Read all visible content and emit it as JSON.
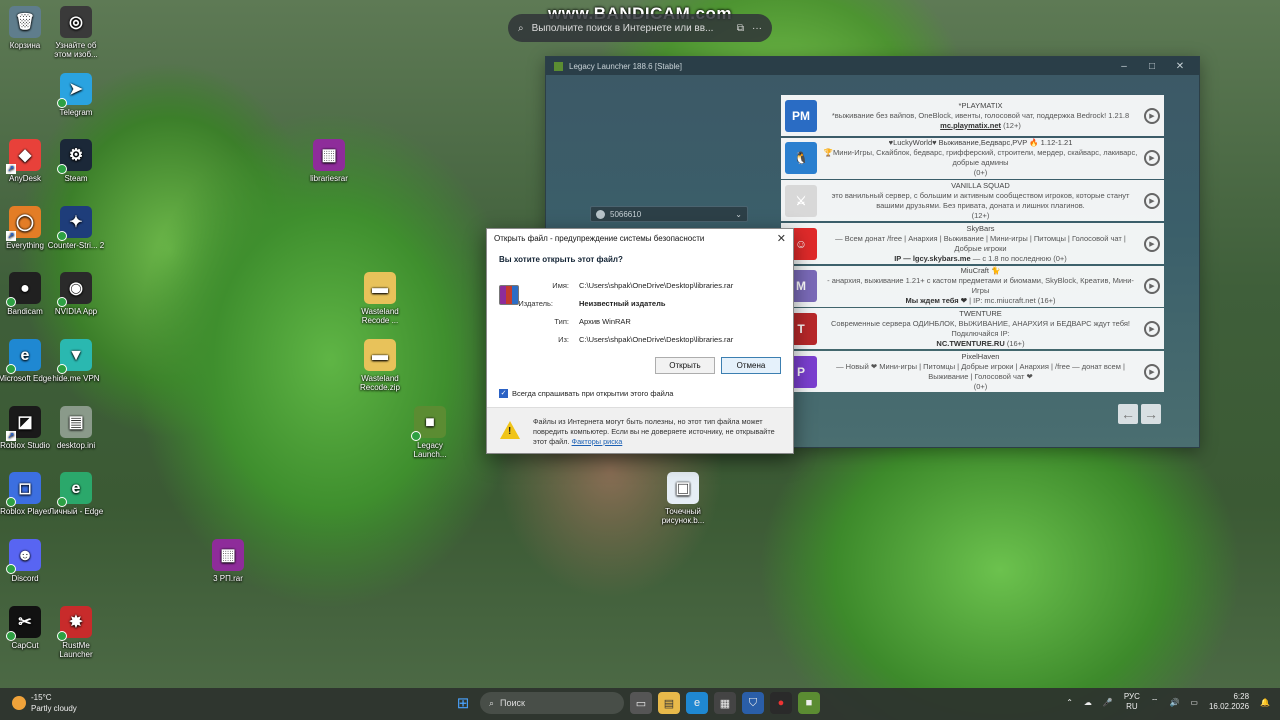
{
  "overlay": {
    "watermark": "www.BANDICAM.com",
    "search_placeholder": "Выполните поиск в Интернете или вв..."
  },
  "desktop_icons": [
    {
      "label": "Корзина",
      "icon": "recycle-bin-icon",
      "color": "#5f7d8c"
    },
    {
      "label": "Узнайте об этом изоб...",
      "icon": "camera-icon",
      "color": "#3a3a3a"
    },
    {
      "label": "Telegram",
      "icon": "telegram-icon",
      "color": "#2aa3e0"
    },
    {
      "label": "AnyDesk",
      "icon": "anydesk-icon",
      "color": "#e8413a"
    },
    {
      "label": "Steam",
      "icon": "steam-icon",
      "color": "#1b2838"
    },
    {
      "label": "Everything",
      "icon": "search-icon",
      "color": "#e37d26"
    },
    {
      "label": "Counter-Stri... 2",
      "icon": "counter-strike-icon",
      "color": "#1e3d7a"
    },
    {
      "label": "Bandicam",
      "icon": "record-icon",
      "color": "#202020"
    },
    {
      "label": "NVIDIA App",
      "icon": "nvidia-icon",
      "color": "#2a2a2a"
    },
    {
      "label": "Microsoft Edge",
      "icon": "edge-icon",
      "color": "#1f88d2"
    },
    {
      "label": "hide.me VPN",
      "icon": "vpn-icon",
      "color": "#2ab8b0"
    },
    {
      "label": "Roblox Studio",
      "icon": "roblox-studio-icon",
      "color": "#1a1a1a"
    },
    {
      "label": "desktop.ini",
      "icon": "file-icon",
      "color": "#8a9a8a"
    },
    {
      "label": "Roblox Player",
      "icon": "roblox-icon",
      "color": "#3c6fe0"
    },
    {
      "label": "Личный - Edge",
      "icon": "edge-profile-icon",
      "color": "#2ba86b"
    },
    {
      "label": "Discord",
      "icon": "discord-icon",
      "color": "#5865f2"
    },
    {
      "label": "CapCut",
      "icon": "capcut-icon",
      "color": "#111111"
    },
    {
      "label": "RustMe Launcher",
      "icon": "rustme-icon",
      "color": "#c82b2b"
    },
    {
      "label": "librariesrar",
      "icon": "winrar-icon",
      "color": "#8e2c9a"
    },
    {
      "label": "Wasteland Recode ...",
      "icon": "folder-icon",
      "color": "#e8c25a"
    },
    {
      "label": "Wasteland Recode.zip",
      "icon": "zip-folder-icon",
      "color": "#e8c25a"
    },
    {
      "label": "Legacy Launch...",
      "icon": "minecraft-icon",
      "color": "#5b8c32"
    },
    {
      "label": "3 РП.rar",
      "icon": "winrar-icon",
      "color": "#8e2c9a"
    },
    {
      "label": "Точечный рисунок.b...",
      "icon": "bitmap-icon",
      "color": "#e6eef5"
    }
  ],
  "launcher": {
    "title": "Legacy Launcher 188.6 [Stable]",
    "account": "5066610",
    "servers": [
      {
        "name": "*PLAYMATIX",
        "desc": "*выживание без вайпов, OneBlock, ивенты, голосовой чат, поддержка Bedrock! 1.21.8",
        "addr": "mc.playmatix.net",
        "extra": "(12+)",
        "logo_color": "#2a6cc4",
        "logo_text": "PM"
      },
      {
        "name": "♥LuckyWorld♥ Выживание,Бедварс,PVP 🔥 1.12-1.21",
        "desc": "🏆Мини-Игры, Скайблок, бедварс, грифферский, строители, мердер, скайварс, лакиварс, добрые админы",
        "addr": "",
        "extra": "(0+)",
        "logo_color": "#2a7fcf",
        "logo_text": "🐧"
      },
      {
        "name": "VANILLA SQUAD",
        "desc": "это ванильный сервер, с большим и активным сообществом игроков, которые станут вашими друзьями. Без привата, доната и лишних плагинов.",
        "addr": "",
        "extra": "(12+)",
        "logo_color": "#d8d8d8",
        "logo_text": "⚔"
      },
      {
        "name": "SkyBars",
        "desc": "— Всем донат /free | Анархия | Выживание | Мини-игры | Питомцы | Голосовой чат | Добрые игроки",
        "addr": "IP — lgcy.skybars.me",
        "extra": "— с 1.8 по последнюю (0+)",
        "logo_color": "#e02a2a",
        "logo_text": "☺"
      },
      {
        "name": "MiuCraft 🐈",
        "desc": "- анархия, выживание 1.21+ с кастом предметами и биомами, SkyBlock, Креатив, Мини-Игры",
        "addr": "Мы ждем тебя ❤",
        "extra": "| IP: mc.miucraft.net (16+)",
        "logo_color": "#7a6ab8",
        "logo_text": "M"
      },
      {
        "name": "TWENTURE",
        "desc": "Современные сервера ОДИНБЛОК, ВЫЖИВАНИЕ, АНАРХИЯ и БЕДВАРС ждут тебя! Подключайся IP:",
        "addr": "NC.TWENTURE.RU",
        "extra": "(16+)",
        "logo_color": "#b8282a",
        "logo_text": "T"
      },
      {
        "name": "PixelHaven",
        "desc": "— Новый ❤ Мини-игры | Питомцы | Добрые игроки | Анархия | /free — донат всем | Выживание | Голосовой чат ❤",
        "addr": "",
        "extra": "(0+)",
        "logo_color": "#7b3fd0",
        "logo_text": "P"
      }
    ]
  },
  "dialog": {
    "title": "Открыть файл - предупреждение системы безопасности",
    "question": "Вы хотите открыть этот файл?",
    "fields": {
      "name_label": "Имя:",
      "name_value": "C:\\Users\\shpak\\OneDrive\\Desktop\\libraries.rar",
      "publisher_label": "Издатель:",
      "publisher_value": "Неизвестный издатель",
      "type_label": "Тип:",
      "type_value": "Архив WinRAR",
      "from_label": "Из:",
      "from_value": "C:\\Users\\shpak\\OneDrive\\Desktop\\libraries.rar"
    },
    "open_button": "Открыть",
    "cancel_button": "Отмена",
    "checkbox_label": "Всегда спрашивать при открытии этого файла",
    "checkbox_checked": true,
    "warning_text": "Файлы из Интернета могут быть полезны, но этот тип файла может повредить компьютер. Если вы не доверяете источнику, не открывайте этот файл.",
    "warning_link": "Факторы риска"
  },
  "taskbar": {
    "weather_temp": "-15°C",
    "weather_desc": "Partly cloudy",
    "search_label": "Поиск",
    "lang_top": "РУС",
    "lang_bottom": "RU",
    "time": "6:28",
    "date": "16.02.2026"
  }
}
